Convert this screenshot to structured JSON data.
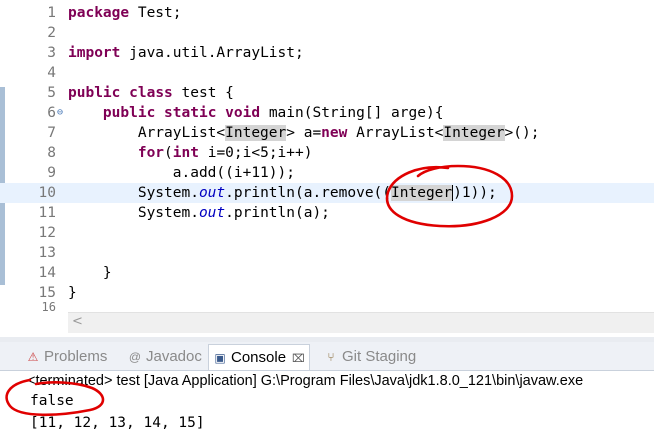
{
  "editor": {
    "lines": [
      {
        "n": "1",
        "html": "<span class=\"kw\">package</span> Test;"
      },
      {
        "n": "2",
        "html": ""
      },
      {
        "n": "3",
        "html": "<span class=\"kw\">import</span> java.util.ArrayList;"
      },
      {
        "n": "4",
        "html": ""
      },
      {
        "n": "5",
        "html": "<span class=\"kw\">public</span> <span class=\"kw\">class</span> test {"
      },
      {
        "n": "6",
        "fold": true,
        "html": "    <span class=\"kw\">public</span> <span class=\"kw\">static</span> <span class=\"kw\">void</span> main(String[] arge){"
      },
      {
        "n": "7",
        "html": "        ArrayList&lt;<span class=\"occ\">Integer</span>&gt; a=<span class=\"kw\">new</span> ArrayList&lt;<span class=\"occ\">Integer</span>&gt;();"
      },
      {
        "n": "8",
        "html": "        <span class=\"kw\">for</span>(<span class=\"kw\">int</span> i=0;i&lt;5;i++)"
      },
      {
        "n": "9",
        "html": "            a.add((i+11));"
      },
      {
        "n": "10",
        "current": true,
        "html": "        System.<span class=\"fld\">out</span>.println(a.remove((<span class=\"occ caret\">Integer</span>)1));"
      },
      {
        "n": "11",
        "html": "        System.<span class=\"fld\">out</span>.println(a);"
      },
      {
        "n": "12",
        "html": ""
      },
      {
        "n": "13",
        "html": ""
      },
      {
        "n": "14",
        "html": "    }"
      },
      {
        "n": "15",
        "html": "}"
      },
      {
        "n": "16",
        "html": ""
      }
    ]
  },
  "panel": {
    "tabs": [
      {
        "label": "Problems",
        "icon": "problems-icon",
        "glyph": "⚠",
        "active": false
      },
      {
        "label": "Javadoc",
        "icon": "javadoc-icon",
        "glyph": "@",
        "active": false
      },
      {
        "label": "Console",
        "icon": "console-icon",
        "glyph": "▣",
        "active": true
      },
      {
        "label": "Git Staging",
        "icon": "git-staging-icon",
        "glyph": "⑂",
        "active": false
      }
    ],
    "close_glyph": "⌧",
    "terminated": "<terminated> test [Java Application] G:\\Program Files\\Java\\jdk1.8.0_121\\bin\\javaw.exe",
    "output": [
      "false",
      "[11, 12, 13, 14, 15]"
    ]
  },
  "scroll_arrow": "<",
  "colors": {
    "keyword": "#7f0055",
    "field": "#0000c0",
    "current_line": "#e8f2fe",
    "annotation": "#e00000"
  }
}
